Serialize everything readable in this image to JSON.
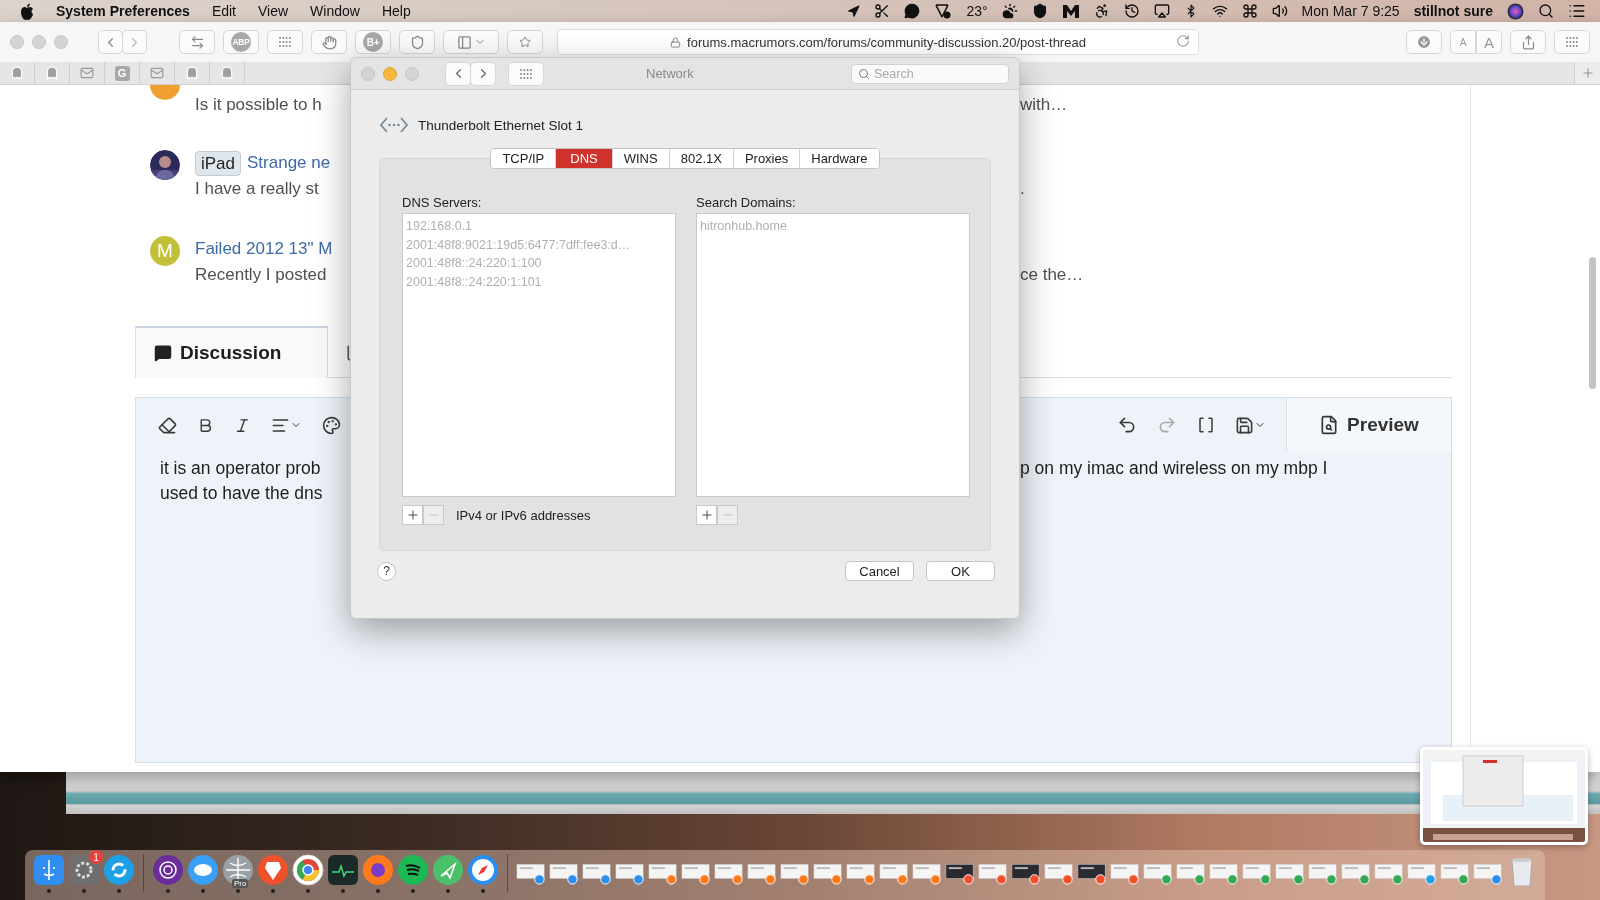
{
  "menu_bar": {
    "app_name": "System Preferences",
    "menus": [
      "Edit",
      "View",
      "Window",
      "Help"
    ],
    "temperature": "23°",
    "date_time": "Mon Mar 7  9:25",
    "user_name": "stillnot sure"
  },
  "browser": {
    "extension_labels": [
      "ABP",
      "B+"
    ],
    "url": "forums.macrumors.com/forums/community-discussion.20/post-thread",
    "text_size_buttons": [
      "A",
      "A"
    ],
    "bookmark_letter": "G",
    "threads": [
      {
        "avatar": {
          "kind": "letter",
          "color": "#f0a030"
        },
        "excerpt": "Is it possible to h",
        "excerpt_end": "with…"
      },
      {
        "prefix": "iPad",
        "title": "Strange ne",
        "excerpt": "I have a really st",
        "excerpt_end": "."
      },
      {
        "avatar": {
          "kind": "letter",
          "color": "#c2c038",
          "letter": "M"
        },
        "title": "Failed 2012 13\" M",
        "excerpt": "Recently I posted",
        "excerpt_end": "ce the…"
      }
    ],
    "tabs": [
      {
        "label": "Discussion",
        "selected": true
      },
      {
        "selected": false
      }
    ],
    "editor": {
      "preview_button": "Preview",
      "lines": [
        {
          "start": "it is an operator prob",
          "end": "p on my imac and wireless on my mbp I"
        },
        {
          "start": "used to have the dns"
        }
      ]
    }
  },
  "network_dialog": {
    "title": "Network",
    "search_placeholder": "Search",
    "interface": "Thunderbolt Ethernet Slot 1",
    "tabs": [
      {
        "label": "TCP/IP",
        "selected": false
      },
      {
        "label": "DNS",
        "selected": true
      },
      {
        "label": "WINS",
        "selected": false
      },
      {
        "label": "802.1X",
        "selected": false
      },
      {
        "label": "Proxies",
        "selected": false
      },
      {
        "label": "Hardware",
        "selected": false
      }
    ],
    "dns_servers": {
      "label": "DNS Servers:",
      "disabled": true,
      "entries": [
        "192.168.0.1",
        "2001:48f8:9021:19d5:6477:7dff:fee3:d…",
        "2001:48f8::24:220:1:100",
        "2001:48f8::24:220:1:101"
      ],
      "hint": "IPv4 or IPv6 addresses"
    },
    "search_domains": {
      "label": "Search Domains:",
      "disabled": true,
      "entries": [
        "hitronhub.home"
      ]
    },
    "help": "?",
    "cancel": "Cancel",
    "ok": "OK"
  },
  "dock": {
    "notification_badge": "1",
    "app_caption": "Pro"
  }
}
